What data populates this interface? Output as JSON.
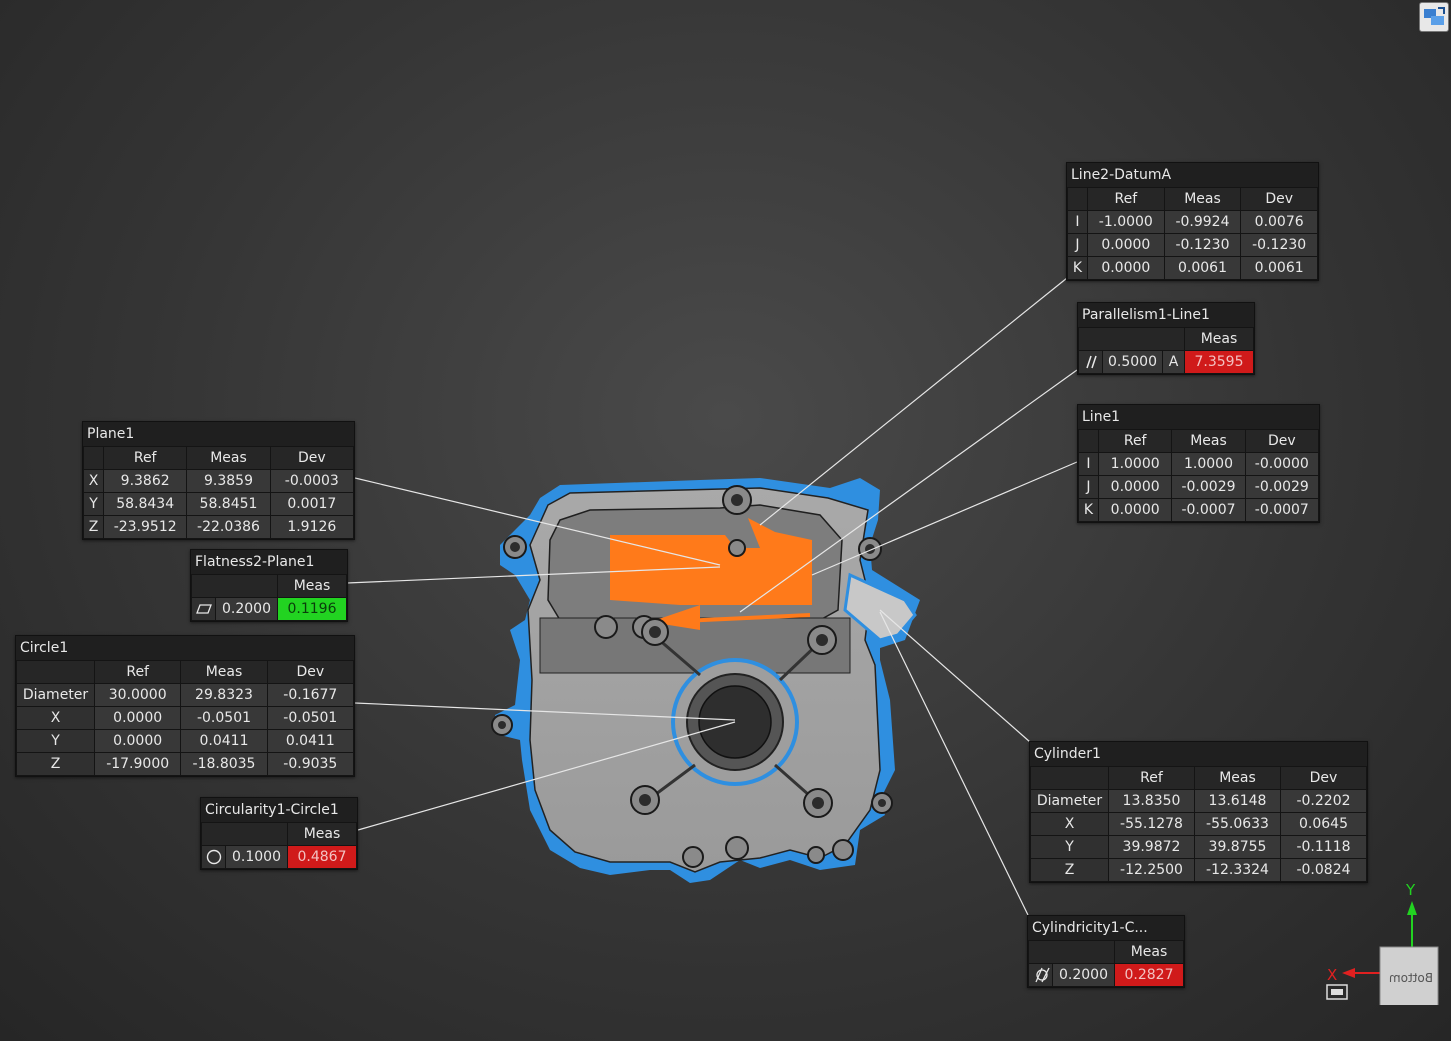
{
  "panels": {
    "line2": {
      "title": "Line2-DatumA",
      "headers": [
        "Ref",
        "Meas",
        "Dev"
      ],
      "rows": [
        {
          "label": "I",
          "ref": "-1.0000",
          "meas": "-0.9924",
          "dev": "0.0076"
        },
        {
          "label": "J",
          "ref": "0.0000",
          "meas": "-0.1230",
          "dev": "-0.1230"
        },
        {
          "label": "K",
          "ref": "0.0000",
          "meas": "0.0061",
          "dev": "0.0061"
        }
      ]
    },
    "parallelism": {
      "title": "Parallelism1-Line1",
      "meas_header": "Meas",
      "tolerance": "0.5000",
      "datum": "A",
      "meas": "7.3595",
      "symbol": "parallelism-icon",
      "status_color": "#d01a1a"
    },
    "line1": {
      "title": "Line1",
      "headers": [
        "Ref",
        "Meas",
        "Dev"
      ],
      "rows": [
        {
          "label": "I",
          "ref": "1.0000",
          "meas": "1.0000",
          "dev": "-0.0000"
        },
        {
          "label": "J",
          "ref": "0.0000",
          "meas": "-0.0029",
          "dev": "-0.0029"
        },
        {
          "label": "K",
          "ref": "0.0000",
          "meas": "-0.0007",
          "dev": "-0.0007"
        }
      ]
    },
    "plane1": {
      "title": "Plane1",
      "headers": [
        "Ref",
        "Meas",
        "Dev"
      ],
      "rows": [
        {
          "label": "X",
          "ref": "9.3862",
          "meas": "9.3859",
          "dev": "-0.0003"
        },
        {
          "label": "Y",
          "ref": "58.8434",
          "meas": "58.8451",
          "dev": "0.0017"
        },
        {
          "label": "Z",
          "ref": "-23.9512",
          "meas": "-22.0386",
          "dev": "1.9126"
        }
      ]
    },
    "flatness": {
      "title": "Flatness2-Plane1",
      "meas_header": "Meas",
      "tolerance": "0.2000",
      "meas": "0.1196",
      "symbol": "flatness-icon",
      "status_color": "#22d321"
    },
    "circle1": {
      "title": "Circle1",
      "headers": [
        "Ref",
        "Meas",
        "Dev"
      ],
      "rows": [
        {
          "label": "Diameter",
          "ref": "30.0000",
          "meas": "29.8323",
          "dev": "-0.1677"
        },
        {
          "label": "X",
          "ref": "0.0000",
          "meas": "-0.0501",
          "dev": "-0.0501"
        },
        {
          "label": "Y",
          "ref": "0.0000",
          "meas": "0.0411",
          "dev": "0.0411"
        },
        {
          "label": "Z",
          "ref": "-17.9000",
          "meas": "-18.8035",
          "dev": "-0.9035"
        }
      ]
    },
    "circularity": {
      "title": "Circularity1-Circle1",
      "meas_header": "Meas",
      "tolerance": "0.1000",
      "meas": "0.4867",
      "symbol": "circularity-icon",
      "status_color": "#d01a1a"
    },
    "cylinder1": {
      "title": "Cylinder1",
      "headers": [
        "Ref",
        "Meas",
        "Dev"
      ],
      "rows": [
        {
          "label": "Diameter",
          "ref": "13.8350",
          "meas": "13.6148",
          "dev": "-0.2202"
        },
        {
          "label": "X",
          "ref": "-55.1278",
          "meas": "-55.0633",
          "dev": "0.0645"
        },
        {
          "label": "Y",
          "ref": "39.9872",
          "meas": "39.8755",
          "dev": "-0.1118"
        },
        {
          "label": "Z",
          "ref": "-12.2500",
          "meas": "-12.3324",
          "dev": "-0.0824"
        }
      ]
    },
    "cylindricity": {
      "title": "Cylindricity1-C...",
      "meas_header": "Meas",
      "tolerance": "0.2000",
      "meas": "0.2827",
      "symbol": "cylindricity-icon",
      "status_color": "#d01a1a"
    }
  },
  "triad": {
    "x_label": "X",
    "y_label": "Y",
    "cube_face": "Bottom",
    "x_color": "#e02020",
    "y_color": "#22d321"
  },
  "colors": {
    "part_outline": "#2f8fe0",
    "feature_highlight": "#ff7a1a"
  },
  "icons": [
    "view-toggle-icon",
    "fit-view-icon"
  ]
}
